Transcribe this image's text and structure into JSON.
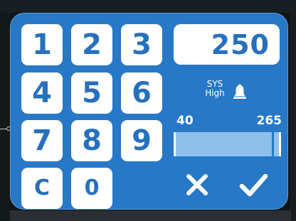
{
  "keypad": {
    "keys": [
      {
        "label": "1",
        "name": "key-1"
      },
      {
        "label": "2",
        "name": "key-2"
      },
      {
        "label": "3",
        "name": "key-3"
      },
      {
        "label": "4",
        "name": "key-4"
      },
      {
        "label": "5",
        "name": "key-5"
      },
      {
        "label": "6",
        "name": "key-6"
      },
      {
        "label": "7",
        "name": "key-7"
      },
      {
        "label": "8",
        "name": "key-8"
      },
      {
        "label": "9",
        "name": "key-9"
      },
      {
        "label": "C",
        "name": "clear-key"
      },
      {
        "label": "0",
        "name": "key-0"
      }
    ]
  },
  "display": {
    "value": "250"
  },
  "alarm": {
    "line1": "SYS",
    "line2": "High",
    "icon": "bell-icon"
  },
  "range": {
    "min_label": "40",
    "max_label": "265",
    "min_value": 40,
    "max_value": 265,
    "current_value": 250
  },
  "actions": {
    "cancel_icon": "close-icon",
    "confirm_icon": "check-icon"
  },
  "colors": {
    "dialog_background": "#2778c6",
    "key_background": "#ffffff",
    "key_text": "#2670bd",
    "range_fill": "#8fc0ec"
  }
}
